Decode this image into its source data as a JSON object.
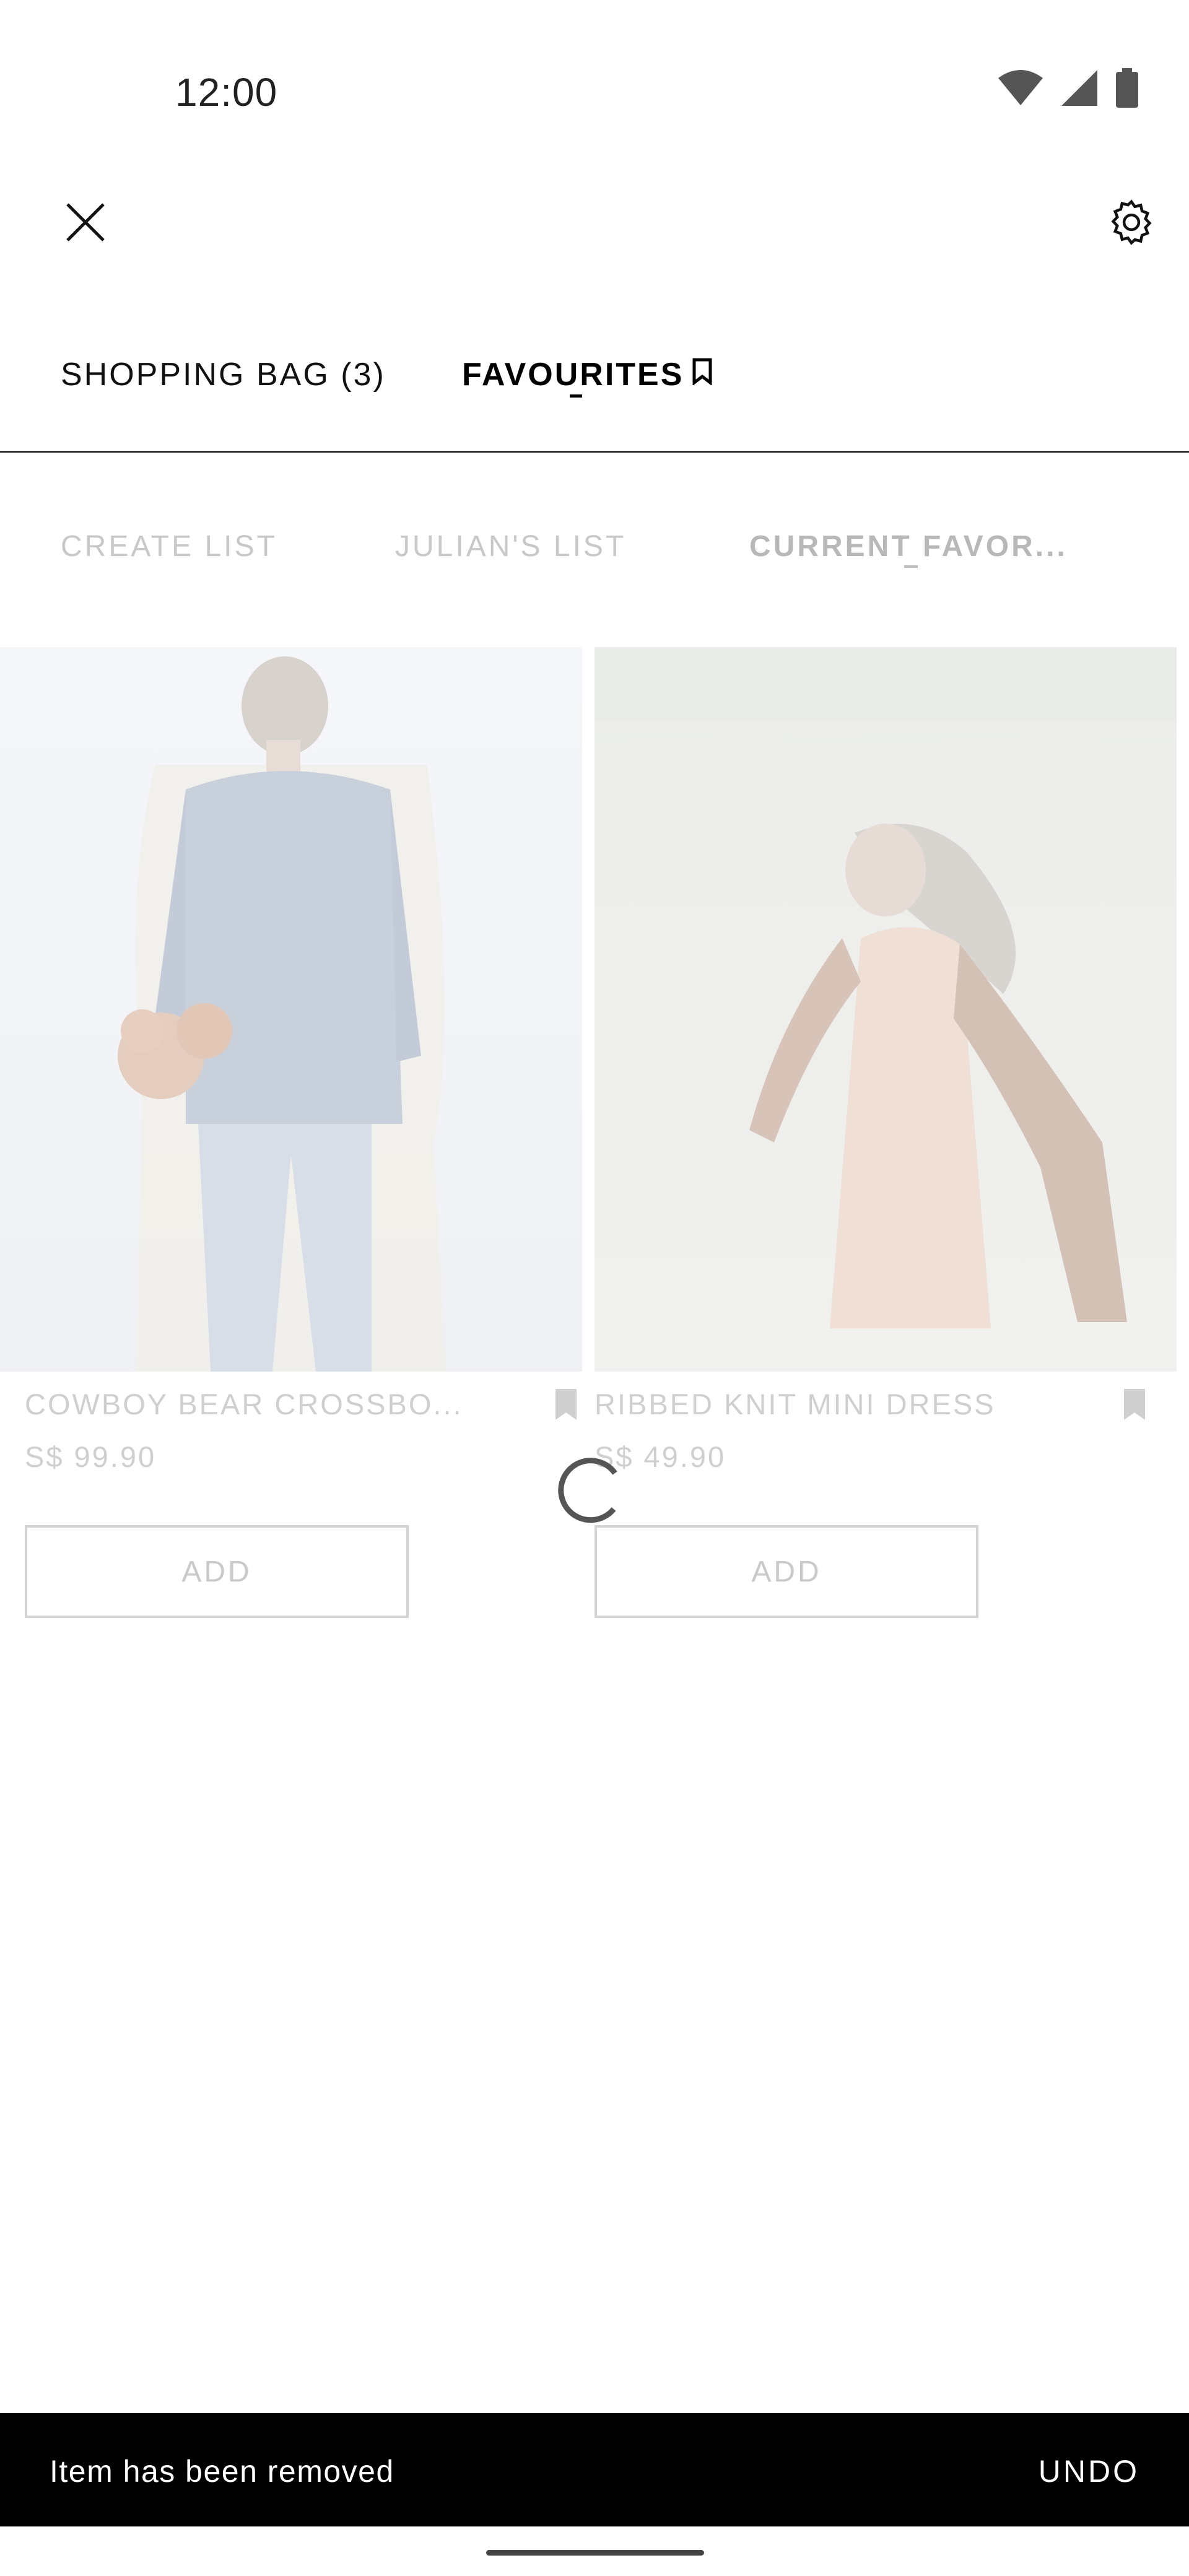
{
  "status_bar": {
    "time": "12:00",
    "icons": [
      "wifi-icon",
      "signal-icon",
      "battery-icon"
    ]
  },
  "top_bar": {
    "close_icon": "close-icon",
    "settings_icon": "gear-icon"
  },
  "tabs": [
    {
      "label": "SHOPPING BAG (3)",
      "active": false
    },
    {
      "label": "FAVOURITES",
      "active": true,
      "icon": "bookmark-outline-icon"
    }
  ],
  "lists": [
    {
      "label": "CREATE LIST"
    },
    {
      "label": "JULIAN'S LIST"
    },
    {
      "label": "CURRENT FAVOR...",
      "active": true
    }
  ],
  "products": [
    {
      "name": "COWBOY BEAR CROSSBO...",
      "price": "S$ 99.90",
      "add_label": "ADD",
      "bookmark_icon": "bookmark-filled-icon"
    },
    {
      "name": "RIBBED KNIT MINI DRESS",
      "price": "S$ 49.90",
      "add_label": "ADD",
      "bookmark_icon": "bookmark-filled-icon"
    }
  ],
  "loading": true,
  "snackbar": {
    "message": "Item has been removed",
    "action": "UNDO"
  },
  "colors": {
    "accent": "#000000",
    "faded_text": "#cfcfcf",
    "snackbar_bg": "#000000"
  }
}
